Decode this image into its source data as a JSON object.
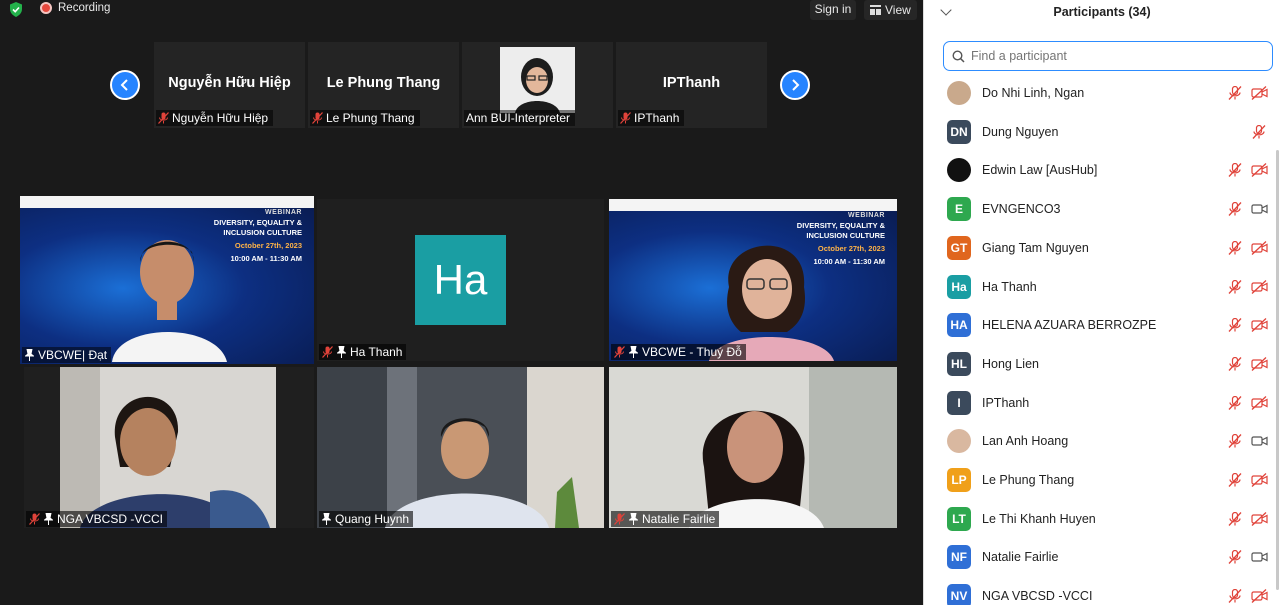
{
  "topbar": {
    "recording_label": "Recording",
    "signin_label": "Sign in",
    "view_label": "View"
  },
  "filmstrip": [
    {
      "big_name": "Nguyễn Hữu Hiệp",
      "label": "Nguyễn Hữu Hiệp",
      "muted": true,
      "video": false
    },
    {
      "big_name": "Le Phung Thang",
      "label": "Le Phung Thang",
      "muted": true,
      "video": false
    },
    {
      "big_name": "",
      "label": "Ann BUI-Interpreter",
      "muted": false,
      "video": true
    },
    {
      "big_name": "IPThanh",
      "label": "IPThanh",
      "muted": true,
      "video": false
    }
  ],
  "banner": {
    "line1": "WEBINAR",
    "line2": "DIVERSITY, EQUALITY &",
    "line3": "INCLUSION CULTURE",
    "date": "October 27th, 2023",
    "time": "10:00 AM - 11:30 AM"
  },
  "grid": [
    {
      "label": "VBCWE| Đạt",
      "muted": false,
      "pinned": true
    },
    {
      "label": "Ha Thanh",
      "muted": true,
      "pinned": true,
      "avatar_text": "Ha"
    },
    {
      "label": "VBCWE - Thuý Đỗ",
      "muted": true,
      "pinned": true
    },
    {
      "label": "NGA VBCSD -VCCI",
      "muted": true,
      "pinned": true
    },
    {
      "label": "Quang Huynh",
      "muted": false,
      "pinned": true
    },
    {
      "label": "Natalie Fairlie",
      "muted": true,
      "pinned": true
    }
  ],
  "panel": {
    "title": "Participants (34)",
    "search_placeholder": "Find a participant",
    "participants": [
      {
        "initials": "",
        "name": "Do Nhi Linh, Ngan",
        "color": "#c9a98c",
        "mic": "muted",
        "cam": "off"
      },
      {
        "initials": "DN",
        "name": "Dung Nguyen",
        "color": "#3b4a5c",
        "mic": "muted",
        "cam": "none"
      },
      {
        "initials": "",
        "name": "Edwin Law [AusHub]",
        "color": "#111111",
        "mic": "muted",
        "cam": "off"
      },
      {
        "initials": "E",
        "name": "EVNGENCO3",
        "color": "#2ea84f",
        "mic": "muted",
        "cam": "on"
      },
      {
        "initials": "GT",
        "name": "Giang Tam Nguyen",
        "color": "#e0661e",
        "mic": "muted",
        "cam": "off"
      },
      {
        "initials": "Ha",
        "name": "Ha Thanh",
        "color": "#1a9ea3",
        "mic": "muted",
        "cam": "off"
      },
      {
        "initials": "HA",
        "name": "HELENA AZUARA BERROZPE",
        "color": "#2f6fd6",
        "mic": "muted",
        "cam": "off"
      },
      {
        "initials": "HL",
        "name": "Hong Lien",
        "color": "#3b4a5c",
        "mic": "muted",
        "cam": "off"
      },
      {
        "initials": "I",
        "name": "IPThanh",
        "color": "#3b4a5c",
        "mic": "muted",
        "cam": "off"
      },
      {
        "initials": "",
        "name": "Lan Anh Hoang",
        "color": "#d9b8a0",
        "mic": "muted",
        "cam": "on"
      },
      {
        "initials": "LP",
        "name": "Le Phung Thang",
        "color": "#f0a01a",
        "mic": "muted",
        "cam": "off"
      },
      {
        "initials": "LT",
        "name": "Le Thi Khanh Huyen",
        "color": "#2ea84f",
        "mic": "muted",
        "cam": "off"
      },
      {
        "initials": "NF",
        "name": "Natalie Fairlie",
        "color": "#2f6fd6",
        "mic": "muted",
        "cam": "on"
      },
      {
        "initials": "NV",
        "name": "NGA VBCSD -VCCI",
        "color": "#2f6fd6",
        "mic": "muted",
        "cam": "off"
      }
    ]
  }
}
